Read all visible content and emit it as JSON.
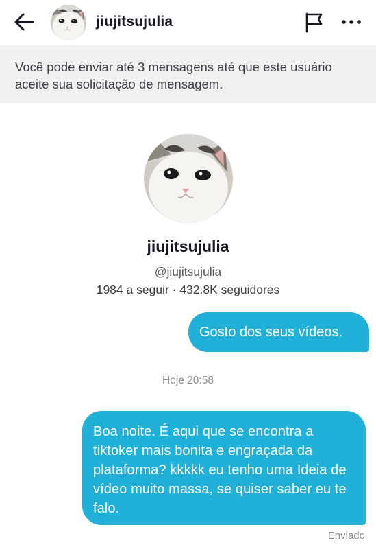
{
  "header": {
    "username": "jiujitsujulia",
    "icons": {
      "back": "arrow-left-icon",
      "report": "flag-icon",
      "more": "more-horizontal-icon"
    }
  },
  "notice": {
    "text": "Você pode enviar até 3 mensagens até que este usuário aceite sua solicitação de mensagem."
  },
  "profile": {
    "name": "jiujitsujulia",
    "handle": "@jiujitsujulia",
    "stats": "1984 a seguir · 432.8K seguidores"
  },
  "messages": [
    {
      "text": "Gosto dos seus vídeos."
    },
    {
      "text": "Boa noite. É aqui que se encontra a tiktoker mais bonita e engraçada da plataforma? kkkkk eu tenho uma Ideia de vídeo muito massa, se quiser saber eu te falo."
    }
  ],
  "timestamp": "Hoje 20:58",
  "status": "Enviado",
  "colors": {
    "bubble": "#20b0d8",
    "notice_bg": "#f1f1f2",
    "text": "#161823"
  }
}
